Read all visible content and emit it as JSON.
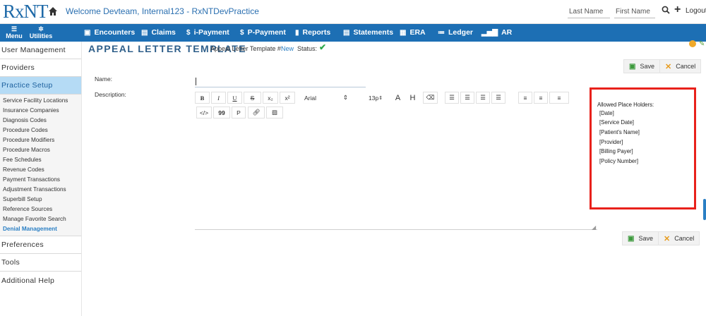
{
  "header": {
    "logo_text": "RxNT",
    "welcome_text": "Welcome  Devteam, Internal123 - RxNTDevPractice",
    "last_name_placeholder": "Last Name",
    "first_name_placeholder": "First Name",
    "logout_label": "Logout",
    "plus_label": "+"
  },
  "nav": {
    "menu_label": "Menu",
    "utilities_label": "Utilities",
    "items": [
      {
        "label": "Encounters",
        "icon": "encounters-icon"
      },
      {
        "label": "Claims",
        "icon": "claims-icon"
      },
      {
        "label": "i-Payment",
        "icon": "dollar-icon"
      },
      {
        "label": "P-Payment",
        "icon": "dollar-icon"
      },
      {
        "label": "Reports",
        "icon": "reports-icon"
      },
      {
        "label": "Statements",
        "icon": "statements-icon"
      },
      {
        "label": "ERA",
        "icon": "era-icon"
      },
      {
        "label": "Ledger",
        "icon": "ledger-icon"
      },
      {
        "label": "AR",
        "icon": "bar-chart-icon"
      }
    ]
  },
  "sidebar": {
    "sections": [
      {
        "label": "User Management"
      },
      {
        "label": "Providers"
      },
      {
        "label": "Practice Setup"
      },
      {
        "label": "Preferences"
      },
      {
        "label": "Tools"
      },
      {
        "label": "Additional Help"
      }
    ],
    "practice_setup_items": [
      "Service Facility Locations",
      "Insurance Companies",
      "Diagnosis Codes",
      "Procedure Codes",
      "Procedure Modifiers",
      "Procedure Macros",
      "Fee Schedules",
      "Revenue Codes",
      "Payment Transactions",
      "Adjustment Transactions",
      "Superbill Setup",
      "Reference Sources",
      "Manage Favorite Search",
      "Denial Management"
    ]
  },
  "main": {
    "title": "APPEAL LETTER TEMPLATE",
    "template_label": "Appeal Letter Template #:",
    "template_number": "New",
    "status_label": "Status:",
    "save_label": "Save",
    "cancel_label": "Cancel",
    "name_label": "Name:",
    "description_label": "Description:",
    "name_value": ""
  },
  "editor": {
    "bold": "B",
    "italic": "I",
    "underline": "U",
    "strike": "S",
    "subscript": "x₂",
    "superscript": "x²",
    "font_family": "Arial",
    "font_size": "13p",
    "font_color": "A",
    "highlight": "H",
    "code": "</>",
    "quote": "99",
    "paragraph": "P"
  },
  "placeholders": {
    "title": "Allowed Place Holders:",
    "items": [
      "[Date]",
      "[Service Date]",
      "[Patient's Name]",
      "[Provider]",
      "[Billing Payer]",
      "[Policy Number]"
    ]
  },
  "colors": {
    "brand_blue": "#1d6fb4",
    "active_section": "#b5dbf5",
    "highlight_red": "#e8211b",
    "save_green": "#3d9a3d",
    "cancel_orange": "#e79b1d"
  }
}
